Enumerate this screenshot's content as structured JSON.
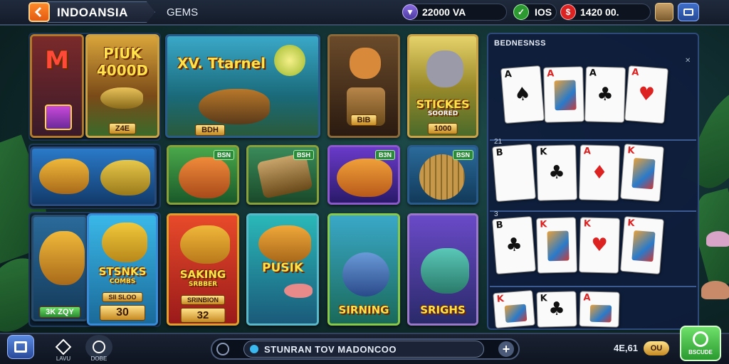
{
  "header": {
    "title": "INDOANSIA",
    "tab": "GEMS",
    "currency_1": "22000 VA",
    "currency_2": "IOS",
    "currency_3": "1420 00.",
    "colors": {
      "accent": "#ff8a2a",
      "gold": "#ffe24a",
      "green": "#2c9a30",
      "red": "#d22222",
      "blue": "#3f6fc9"
    }
  },
  "games": {
    "g1": {
      "title": "M",
      "chip": ""
    },
    "g2": {
      "title": "PIUK 4000D",
      "chip": "Z4E"
    },
    "g3": {
      "title": "XV. Ttarnel",
      "chip": "BDH"
    },
    "g4": {
      "title": "",
      "chip": "BIB"
    },
    "g5": {
      "title": "STICKES",
      "subtitle": "SOORED",
      "chip": "1000"
    },
    "g7": {
      "badge": "BSN"
    },
    "g8": {
      "badge": "BSH"
    },
    "g9": {
      "badge": "B3N"
    },
    "g10": {
      "badge": "BSN"
    },
    "g11": {
      "chip": "3K ZQY"
    },
    "g12": {
      "title": "STSNKS",
      "subtitle": "COMBS",
      "chip_top": "SII SLOO",
      "chip": "30"
    },
    "g13": {
      "title": "SAKING",
      "subtitle": "SRBBER",
      "chip_top": "SRINBION",
      "chip": "32"
    },
    "g14": {
      "title": "PUSIK"
    },
    "g15": {
      "title": "SIRNING"
    },
    "g16": {
      "title": "SRIGHS"
    }
  },
  "cards_panel": {
    "title": "BEDNESNSS",
    "rows": [
      {
        "label": "",
        "cards": [
          {
            "rank": "A",
            "suit": "♠",
            "color": "blk"
          },
          {
            "rank": "A",
            "suit": "",
            "color": "red",
            "face": true
          },
          {
            "rank": "A",
            "suit": "♣",
            "color": "blk"
          },
          {
            "rank": "A",
            "suit": "♥",
            "color": "red"
          }
        ]
      },
      {
        "label": "21",
        "cards": [
          {
            "rank": "B",
            "suit": "",
            "color": "blk"
          },
          {
            "rank": "K",
            "suit": "♣",
            "color": "blk"
          },
          {
            "rank": "A",
            "suit": "♦",
            "color": "red"
          },
          {
            "rank": "K",
            "suit": "",
            "color": "red",
            "face": true
          }
        ]
      },
      {
        "label": "3",
        "cards": [
          {
            "rank": "B",
            "suit": "♣",
            "color": "blk"
          },
          {
            "rank": "K",
            "suit": "",
            "color": "red",
            "face": true
          },
          {
            "rank": "K",
            "suit": "♥",
            "color": "red"
          },
          {
            "rank": "K",
            "suit": "",
            "color": "red",
            "face": true
          }
        ]
      },
      {
        "label": "",
        "cards": [
          {
            "rank": "K",
            "suit": "",
            "color": "red",
            "face": true
          },
          {
            "rank": "K",
            "suit": "♣",
            "color": "blk"
          },
          {
            "rank": "A",
            "suit": "",
            "color": "red",
            "face": true
          }
        ]
      }
    ]
  },
  "bottom": {
    "nav_1": "",
    "nav_2": "LAVU",
    "nav_3": "DOBE",
    "search_text": "STUNRAN TOV MADONCOO",
    "balance": "4E,61",
    "chip": "OU",
    "play_label": "BSCUDE"
  }
}
